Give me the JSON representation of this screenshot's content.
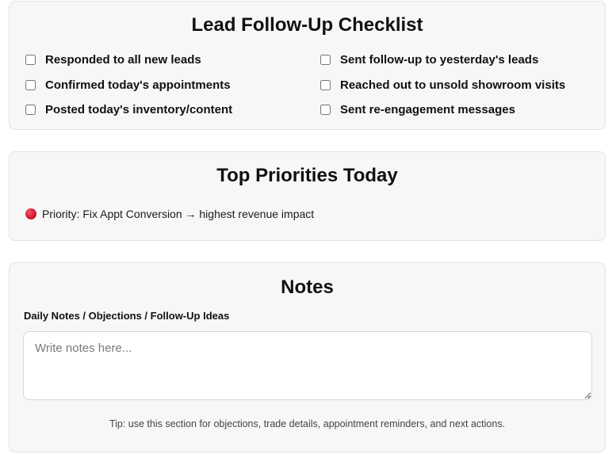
{
  "checklist": {
    "title": "Lead Follow-Up Checklist",
    "items": [
      {
        "label": "Responded to all new leads",
        "checked": false
      },
      {
        "label": "Sent follow-up to yesterday's leads",
        "checked": false
      },
      {
        "label": "Confirmed today's appointments",
        "checked": false
      },
      {
        "label": "Reached out to unsold showroom visits",
        "checked": false
      },
      {
        "label": "Posted today's inventory/content",
        "checked": false
      },
      {
        "label": "Sent re-engagement messages",
        "checked": false
      }
    ]
  },
  "priorities": {
    "title": "Top Priorities Today",
    "item_text": "Priority: Fix Appt Conversion → highest revenue impact",
    "item_icon": "red-circle-icon",
    "dot_color": "#d1172f"
  },
  "notes": {
    "title": "Notes",
    "label": "Daily Notes / Objections / Follow-Up Ideas",
    "placeholder": "Write notes here...",
    "value": "",
    "tip": "Tip: use this section for objections, trade details, appointment reminders, and next actions."
  },
  "colors": {
    "card_background": "#f7f7f7",
    "card_border": "#e2e2e2",
    "text": "#111111"
  }
}
